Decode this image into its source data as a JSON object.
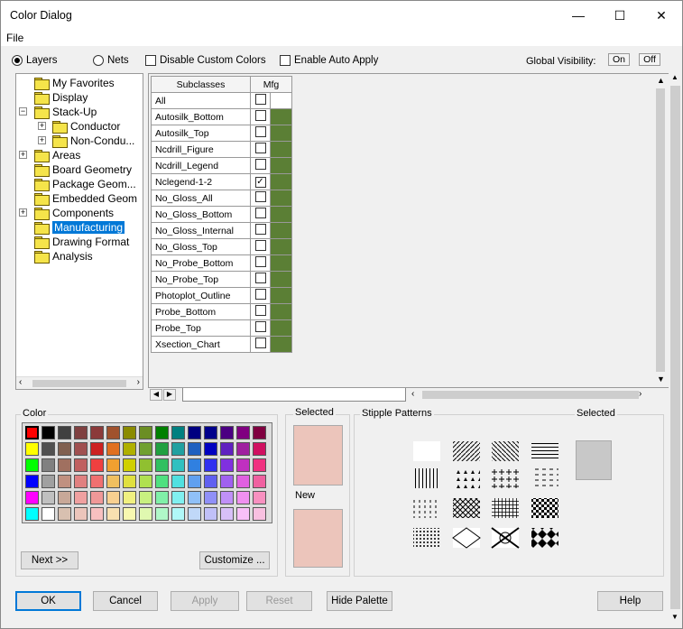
{
  "window": {
    "title": "Color Dialog",
    "minimize": "—",
    "maximize": "☐",
    "close": "✕"
  },
  "menu": {
    "file": "File"
  },
  "toolbar": {
    "layers": "Layers",
    "nets": "Nets",
    "disable_custom": "Disable Custom Colors",
    "enable_auto": "Enable Auto Apply",
    "global_visibility": "Global Visibility:",
    "on": "On",
    "off": "Off"
  },
  "tree": [
    "My Favorites",
    "Display",
    "Stack-Up",
    "Conductor",
    "Non-Condu...",
    "Areas",
    "Board Geometry",
    "Package Geom...",
    "Embedded Geom",
    "Components",
    "Manufacturing",
    "Drawing Format",
    "Analysis"
  ],
  "grid": {
    "col_subclasses": "Subclasses",
    "col_mfg": "Mfg",
    "rows": [
      "All",
      "Autosilk_Bottom",
      "Autosilk_Top",
      "Ncdrill_Figure",
      "Ncdrill_Legend",
      "Nclegend-1-2",
      "No_Gloss_All",
      "No_Gloss_Bottom",
      "No_Gloss_Internal",
      "No_Gloss_Top",
      "No_Probe_Bottom",
      "No_Probe_Top",
      "Photoplot_Outline",
      "Probe_Bottom",
      "Probe_Top",
      "Xsection_Chart"
    ],
    "checked_row": "Nclegend-1-2"
  },
  "color_group": {
    "label": "Color",
    "next": "Next >>",
    "customize": "Customize ..."
  },
  "selected_group": {
    "selected": "Selected",
    "new": "New",
    "color": "#ecc5bb"
  },
  "stipple_group": {
    "label": "Stipple Patterns",
    "selected": "Selected"
  },
  "buttons": {
    "ok": "OK",
    "cancel": "Cancel",
    "apply": "Apply",
    "reset": "Reset",
    "hide_palette": "Hide Palette",
    "help": "Help"
  },
  "palette": [
    [
      "#ff0000",
      "#000000",
      "#404040",
      "#7f4040",
      "#8b3a3a",
      "#a0522d",
      "#8b8b00",
      "#6b8e23",
      "#008000",
      "#008080",
      "#000080",
      "#00008b",
      "#4b0082",
      "#800080",
      "#800040"
    ],
    [
      "#ffff00",
      "#505050",
      "#806050",
      "#a05050",
      "#cc2020",
      "#e07020",
      "#b0b000",
      "#70a030",
      "#20a040",
      "#20a0a0",
      "#2060c0",
      "#0000c0",
      "#6020c0",
      "#a020a0",
      "#d01060"
    ],
    [
      "#00ff00",
      "#808080",
      "#a07060",
      "#c06060",
      "#f04040",
      "#f0a030",
      "#d0d000",
      "#90c030",
      "#30c060",
      "#30c0c0",
      "#3080e0",
      "#3030f0",
      "#8030e0",
      "#c030c0",
      "#f03080"
    ],
    [
      "#0000ff",
      "#a0a0a0",
      "#c09080",
      "#e08080",
      "#f07070",
      "#f0c060",
      "#e0e040",
      "#b0e050",
      "#50e080",
      "#50e0e0",
      "#60a0f0",
      "#6060f0",
      "#a060f0",
      "#e060e0",
      "#f060a0"
    ],
    [
      "#ff00ff",
      "#c0c0c0",
      "#c8a898",
      "#f0a0a0",
      "#f09898",
      "#f8d090",
      "#f0f080",
      "#c8f080",
      "#80f0a8",
      "#80f0f0",
      "#90c0f8",
      "#9090f8",
      "#c090f8",
      "#f090f0",
      "#f890c0"
    ],
    [
      "#00ffff",
      "#ffffff",
      "#d8c0b0",
      "#ecc5bb",
      "#f8c0c0",
      "#f8e0b0",
      "#f8f8b0",
      "#e0f8b0",
      "#b0f8c8",
      "#b0f8f8",
      "#c0d8f8",
      "#c0c0f8",
      "#d8c0f8",
      "#f8c0f8",
      "#f8c0e0"
    ]
  ]
}
